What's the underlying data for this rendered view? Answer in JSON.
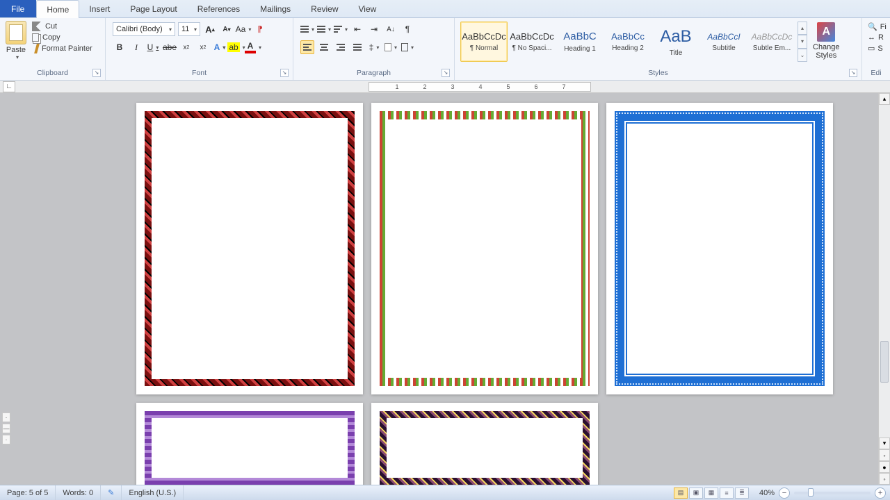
{
  "tabs": {
    "file": "File",
    "home": "Home",
    "insert": "Insert",
    "pageLayout": "Page Layout",
    "references": "References",
    "mailings": "Mailings",
    "review": "Review",
    "view": "View"
  },
  "clipboard": {
    "paste": "Paste",
    "cut": "Cut",
    "copy": "Copy",
    "formatPainter": "Format Painter",
    "group": "Clipboard"
  },
  "font": {
    "name": "Calibri (Body)",
    "size": "11",
    "group": "Font"
  },
  "paragraph": {
    "group": "Paragraph"
  },
  "styles": {
    "group": "Styles",
    "items": [
      {
        "preview": "AaBbCcDc",
        "name": "¶ Normal"
      },
      {
        "preview": "AaBbCcDc",
        "name": "¶ No Spaci..."
      },
      {
        "preview": "AaBbC",
        "name": "Heading 1"
      },
      {
        "preview": "AaBbCc",
        "name": "Heading 2"
      },
      {
        "preview": "AaB",
        "name": "Title"
      },
      {
        "preview": "AaBbCcI",
        "name": "Subtitle"
      },
      {
        "preview": "AaBbCcDc",
        "name": "Subtle Em..."
      }
    ],
    "change": "Change\nStyles"
  },
  "editing": {
    "find": "Fi",
    "replace": "R",
    "select": "S",
    "group": "Edi"
  },
  "ruler": {
    "marks": [
      "1",
      "2",
      "3",
      "4",
      "5",
      "6",
      "7"
    ]
  },
  "status": {
    "page": "Page: 5 of 5",
    "words": "Words: 0",
    "lang": "English (U.S.)",
    "zoom": "40%",
    "zoomPos": 20
  }
}
